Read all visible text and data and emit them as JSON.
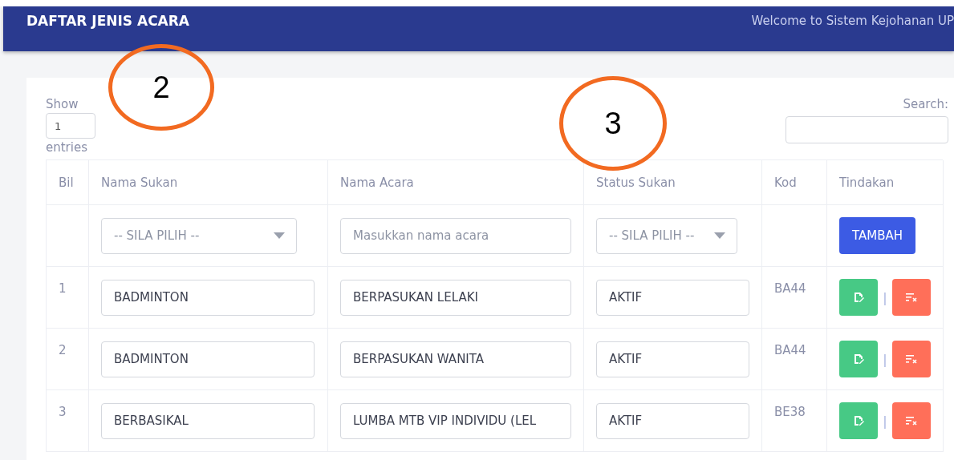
{
  "header": {
    "title": "DAFTAR JENIS ACARA",
    "welcome": "Welcome to Sistem Kejohanan UP"
  },
  "length": {
    "show": "Show",
    "value": "1",
    "entries": "entries"
  },
  "search": {
    "label": "Search:"
  },
  "table": {
    "columns": [
      "Bil",
      "Nama Sukan",
      "Nama Acara",
      "Status Sukan",
      "Kod",
      "Tindakan"
    ],
    "filter": {
      "sport": "-- SILA PILIH --",
      "event_placeholder": "Masukkan nama acara",
      "status": "-- SILA PILIH --",
      "add": "TAMBAH"
    },
    "rows": [
      {
        "bil": "1",
        "sport": "BADMINTON",
        "event": "BERPASUKAN LELAKI",
        "status": "AKTIF",
        "kod": "BA44",
        "separator": "|"
      },
      {
        "bil": "2",
        "sport": "BADMINTON",
        "event": "BERPASUKAN WANITA",
        "status": "AKTIF",
        "kod": "BA44",
        "separator": "|"
      },
      {
        "bil": "3",
        "sport": "BERBASIKAL",
        "event": "LUMBA MTB VIP INDIVIDU (LEL",
        "status": "AKTIF",
        "kod": "BE38",
        "separator": "|"
      }
    ]
  },
  "annotations": [
    {
      "label": "2"
    },
    {
      "label": "3"
    }
  ]
}
